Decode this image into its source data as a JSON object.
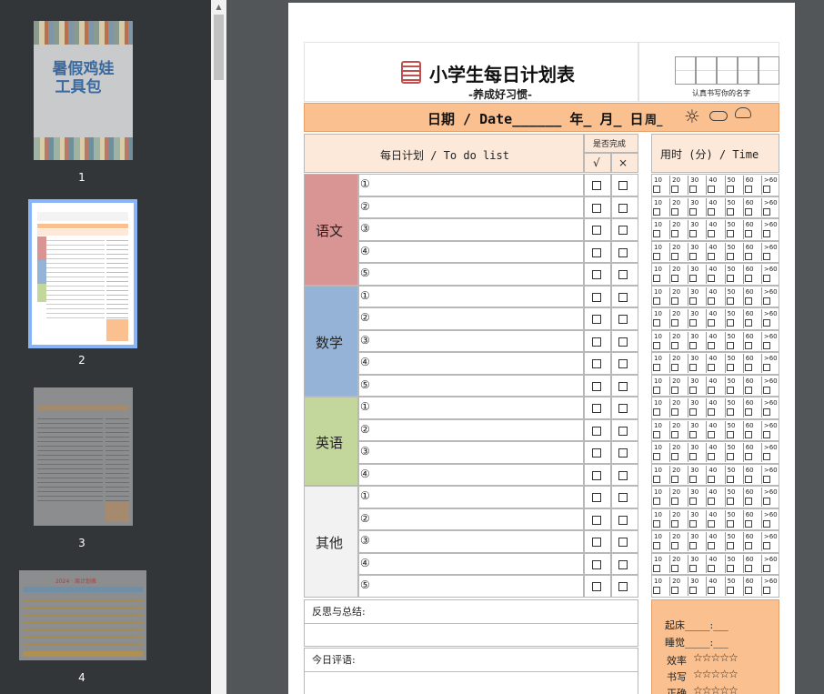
{
  "sidebar": {
    "thumbnails": [
      {
        "number": "1",
        "title_line1": "暑假鸡娃",
        "title_line2": "工具包"
      },
      {
        "number": "2"
      },
      {
        "number": "3"
      },
      {
        "number": "4",
        "mini_title": "2024 · 周计划表"
      }
    ]
  },
  "page": {
    "title": "小学生每日计划表",
    "subtitle": "-养成好习惯-",
    "name_caption": "认真书写你的名字",
    "date_label": "日期 / Date______ 年_ 月_ 日",
    "week_label": "周_",
    "todo_header": "每日计划 / To do list",
    "done_header": "是否完成",
    "done_yes": "√",
    "done_no": "×",
    "time_header": "用时 (分) / Time",
    "time_marks": [
      "10",
      "20",
      "30",
      "40",
      "50",
      "60",
      ">60"
    ],
    "subjects": [
      {
        "name": "语文",
        "color": "#d99594",
        "items": [
          "①",
          "②",
          "③",
          "④",
          "⑤"
        ]
      },
      {
        "name": "数学",
        "color": "#95b3d7",
        "items": [
          "①",
          "②",
          "③",
          "④",
          "⑤"
        ]
      },
      {
        "name": "英语",
        "color": "#c3d69b",
        "items": [
          "①",
          "②",
          "③",
          "④"
        ]
      },
      {
        "name": "其他",
        "color": "#f2f2f2",
        "items": [
          "①",
          "②",
          "③",
          "④",
          "⑤"
        ]
      }
    ],
    "reflection_label": "反思与总结:",
    "comment_label": "今日评语:",
    "wake_label": "起床_____:___",
    "sleep_label": "睡觉_____:___",
    "ratings": [
      {
        "label": "效率",
        "stars": "☆☆☆☆☆"
      },
      {
        "label": "书写",
        "stars": "☆☆☆☆☆"
      },
      {
        "label": "正确",
        "stars": "☆☆☆☆☆"
      }
    ],
    "colors": {
      "accent": "#fac090",
      "header_bg": "#fde9d9"
    }
  }
}
